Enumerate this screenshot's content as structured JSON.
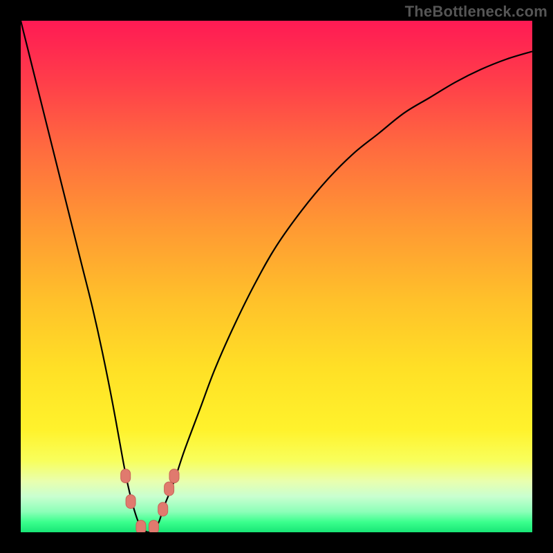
{
  "watermark": "TheBottleneck.com",
  "colors": {
    "page_bg": "#000000",
    "gradient_top": "#ff1a54",
    "gradient_bottom": "#18e676",
    "curve_stroke": "#000000",
    "marker_fill": "#e07a6e"
  },
  "chart_data": {
    "type": "line",
    "title": "",
    "xlabel": "",
    "ylabel": "",
    "xlim": [
      0,
      100
    ],
    "ylim": [
      0,
      100
    ],
    "x": [
      0,
      2,
      4,
      6,
      8,
      10,
      12,
      14,
      16,
      18,
      20,
      21,
      22,
      23,
      24,
      25,
      26,
      27,
      28,
      30,
      32,
      35,
      38,
      42,
      46,
      50,
      55,
      60,
      65,
      70,
      75,
      80,
      85,
      90,
      95,
      100
    ],
    "values": [
      100,
      92,
      84,
      76,
      68,
      60,
      52,
      44,
      35,
      25,
      14,
      9,
      5,
      2,
      0.5,
      0,
      0.5,
      2,
      5,
      10,
      16,
      24,
      32,
      41,
      49,
      56,
      63,
      69,
      74,
      78,
      82,
      85,
      88,
      90.5,
      92.5,
      94
    ],
    "markers": [
      {
        "x": 20.5,
        "y": 11
      },
      {
        "x": 21.5,
        "y": 6
      },
      {
        "x": 23.5,
        "y": 1
      },
      {
        "x": 26.0,
        "y": 1
      },
      {
        "x": 27.8,
        "y": 4.5
      },
      {
        "x": 29.0,
        "y": 8.5
      },
      {
        "x": 30.0,
        "y": 11
      }
    ],
    "minimum_x": 25,
    "note": "V-shaped bottleneck curve; values estimated from pixel positions, 0 = bottom, 100 = top."
  }
}
